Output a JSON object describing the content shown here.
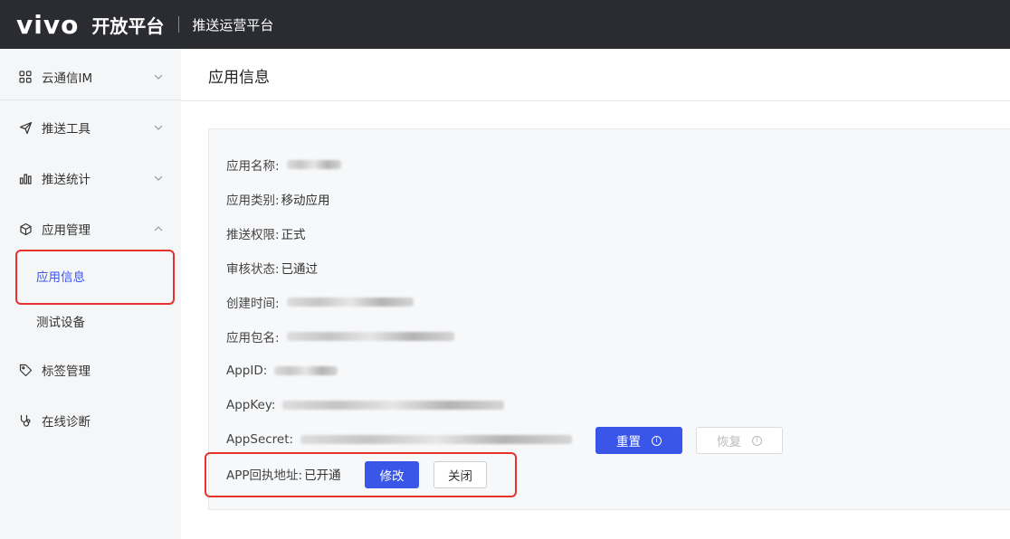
{
  "header": {
    "logo": "vivo",
    "brand": "开放平台",
    "subtitle": "推送运营平台"
  },
  "sidebar": {
    "items": [
      {
        "label": "云通信IM",
        "icon": "grid-icon"
      },
      {
        "label": "推送工具",
        "icon": "send-icon"
      },
      {
        "label": "推送统计",
        "icon": "bar-chart-icon"
      },
      {
        "label": "应用管理",
        "icon": "cube-icon"
      },
      {
        "label": "标签管理",
        "icon": "tag-icon"
      },
      {
        "label": "在线诊断",
        "icon": "stethoscope-icon"
      }
    ],
    "sub_items": [
      {
        "label": "应用信息"
      },
      {
        "label": "测试设备"
      }
    ]
  },
  "main": {
    "title": "应用信息",
    "fields": [
      {
        "label": "应用名称:",
        "value": ""
      },
      {
        "label": "应用类别:",
        "value": "移动应用"
      },
      {
        "label": "推送权限:",
        "value": "正式"
      },
      {
        "label": "审核状态:",
        "value": "已通过"
      },
      {
        "label": "创建时间:",
        "value": ""
      },
      {
        "label": "应用包名:",
        "value": ""
      },
      {
        "label": "AppID:",
        "value": ""
      },
      {
        "label": "AppKey:",
        "value": ""
      },
      {
        "label": "AppSecret:",
        "value": ""
      },
      {
        "label": "APP回执地址:",
        "value": "已开通"
      }
    ],
    "buttons": {
      "reset": "重置",
      "restore": "恢复",
      "modify": "修改",
      "close": "关闭"
    }
  },
  "colors": {
    "primary": "#3a56e8",
    "active_nav": "#3e57e8",
    "highlight": "#e5322d",
    "topbar": "#2b2c31"
  }
}
